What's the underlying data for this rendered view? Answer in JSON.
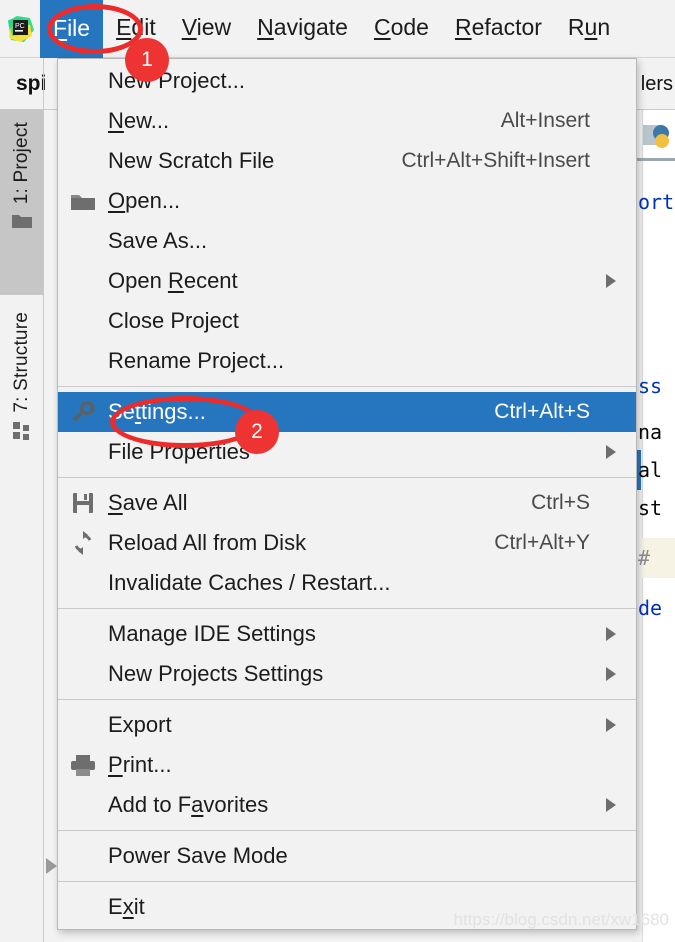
{
  "app": {
    "logo_alt": "pycharm-logo",
    "logo_text": "PC"
  },
  "menubar": {
    "items": [
      {
        "label": "File",
        "pre": "",
        "mn": "F",
        "post": "ile",
        "active": true
      },
      {
        "label": "Edit",
        "pre": "",
        "mn": "E",
        "post": "dit",
        "active": false
      },
      {
        "label": "View",
        "pre": "",
        "mn": "V",
        "post": "iew",
        "active": false
      },
      {
        "label": "Navigate",
        "pre": "",
        "mn": "N",
        "post": "avigate",
        "active": false
      },
      {
        "label": "Code",
        "pre": "",
        "mn": "C",
        "post": "ode",
        "active": false
      },
      {
        "label": "Refactor",
        "pre": "",
        "mn": "R",
        "post": "efactor",
        "active": false
      },
      {
        "label": "Run",
        "pre": "R",
        "mn": "u",
        "post": "n",
        "active": false
      }
    ]
  },
  "tabstrip": {
    "project_name": "spi",
    "right_label": "lers"
  },
  "toolwindows": {
    "project_tab": "1: Project",
    "structure_tab": "7: Structure"
  },
  "editor_peek": {
    "lines": [
      {
        "text": "ort",
        "cls": "ed-blue"
      },
      {
        "text": "ss",
        "cls": "ed-blue"
      },
      {
        "text": "na",
        "cls": "ed-black"
      },
      {
        "text": "al",
        "cls": "ed-black"
      },
      {
        "text": "st",
        "cls": "ed-black"
      },
      {
        "text": "#",
        "cls": "ed-comment"
      },
      {
        "text": "de",
        "cls": "ed-blue"
      }
    ]
  },
  "file_menu": {
    "items": [
      {
        "type": "item",
        "name": "new-project",
        "icon": "",
        "pre": "",
        "mn": "",
        "post": "New Project...",
        "shortcut": "",
        "arrow": false,
        "selected": false
      },
      {
        "type": "item",
        "name": "new",
        "icon": "",
        "pre": "",
        "mn": "N",
        "post": "ew...",
        "shortcut": "Alt+Insert",
        "arrow": false,
        "selected": false
      },
      {
        "type": "item",
        "name": "new-scratch-file",
        "icon": "",
        "pre": "",
        "mn": "",
        "post": "New Scratch File",
        "shortcut": "Ctrl+Alt+Shift+Insert",
        "arrow": false,
        "selected": false
      },
      {
        "type": "item",
        "name": "open",
        "icon": "folder",
        "pre": "",
        "mn": "O",
        "post": "pen...",
        "shortcut": "",
        "arrow": false,
        "selected": false
      },
      {
        "type": "item",
        "name": "save-as",
        "icon": "",
        "pre": "",
        "mn": "",
        "post": "Save As...",
        "shortcut": "",
        "arrow": false,
        "selected": false
      },
      {
        "type": "item",
        "name": "open-recent",
        "icon": "",
        "pre": "Open ",
        "mn": "R",
        "post": "ecent",
        "shortcut": "",
        "arrow": true,
        "selected": false
      },
      {
        "type": "item",
        "name": "close-project",
        "icon": "",
        "pre": "",
        "mn": "",
        "post": "Close Project",
        "shortcut": "",
        "arrow": false,
        "selected": false
      },
      {
        "type": "item",
        "name": "rename-project",
        "icon": "",
        "pre": "",
        "mn": "",
        "post": "Rename Project...",
        "shortcut": "",
        "arrow": false,
        "selected": false
      },
      {
        "type": "sep",
        "name": "separator-1"
      },
      {
        "type": "item",
        "name": "settings",
        "icon": "wrench",
        "pre": "Se",
        "mn": "t",
        "post": "tings...",
        "shortcut": "Ctrl+Alt+S",
        "arrow": false,
        "selected": true
      },
      {
        "type": "item",
        "name": "file-properties",
        "icon": "",
        "pre": "",
        "mn": "",
        "post": "File Properties",
        "shortcut": "",
        "arrow": true,
        "selected": false
      },
      {
        "type": "sep",
        "name": "separator-2"
      },
      {
        "type": "item",
        "name": "save-all",
        "icon": "save",
        "pre": "",
        "mn": "S",
        "post": "ave All",
        "shortcut": "Ctrl+S",
        "arrow": false,
        "selected": false
      },
      {
        "type": "item",
        "name": "reload-all-from-disk",
        "icon": "reload",
        "pre": "",
        "mn": "",
        "post": "Reload All from Disk",
        "shortcut": "Ctrl+Alt+Y",
        "arrow": false,
        "selected": false
      },
      {
        "type": "item",
        "name": "invalidate-caches",
        "icon": "",
        "pre": "",
        "mn": "",
        "post": "Invalidate Caches / Restart...",
        "shortcut": "",
        "arrow": false,
        "selected": false
      },
      {
        "type": "sep",
        "name": "separator-3"
      },
      {
        "type": "item",
        "name": "manage-ide-settings",
        "icon": "",
        "pre": "",
        "mn": "",
        "post": "Manage IDE Settings",
        "shortcut": "",
        "arrow": true,
        "selected": false
      },
      {
        "type": "item",
        "name": "new-projects-settings",
        "icon": "",
        "pre": "",
        "mn": "",
        "post": "New Projects Settings",
        "shortcut": "",
        "arrow": true,
        "selected": false
      },
      {
        "type": "sep",
        "name": "separator-4"
      },
      {
        "type": "item",
        "name": "export",
        "icon": "",
        "pre": "",
        "mn": "",
        "post": "Export",
        "shortcut": "",
        "arrow": true,
        "selected": false
      },
      {
        "type": "item",
        "name": "print",
        "icon": "printer",
        "pre": "",
        "mn": "P",
        "post": "rint...",
        "shortcut": "",
        "arrow": false,
        "selected": false
      },
      {
        "type": "item",
        "name": "add-to-favorites",
        "icon": "",
        "pre": "Add to F",
        "mn": "a",
        "post": "vorites",
        "shortcut": "",
        "arrow": true,
        "selected": false
      },
      {
        "type": "sep",
        "name": "separator-5"
      },
      {
        "type": "item",
        "name": "power-save-mode",
        "icon": "",
        "pre": "",
        "mn": "",
        "post": "Power Save Mode",
        "shortcut": "",
        "arrow": false,
        "selected": false
      },
      {
        "type": "sep",
        "name": "separator-6"
      },
      {
        "type": "item",
        "name": "exit",
        "icon": "",
        "pre": "E",
        "mn": "x",
        "post": "it",
        "shortcut": "",
        "arrow": false,
        "selected": false
      }
    ]
  },
  "annotations": {
    "accent_color": "#ee2b2b",
    "badges": [
      {
        "label": "1",
        "name": "step-badge-1"
      },
      {
        "label": "2",
        "name": "step-badge-2"
      }
    ]
  },
  "watermark": {
    "text": "https://blog.csdn.net/xw1680"
  }
}
